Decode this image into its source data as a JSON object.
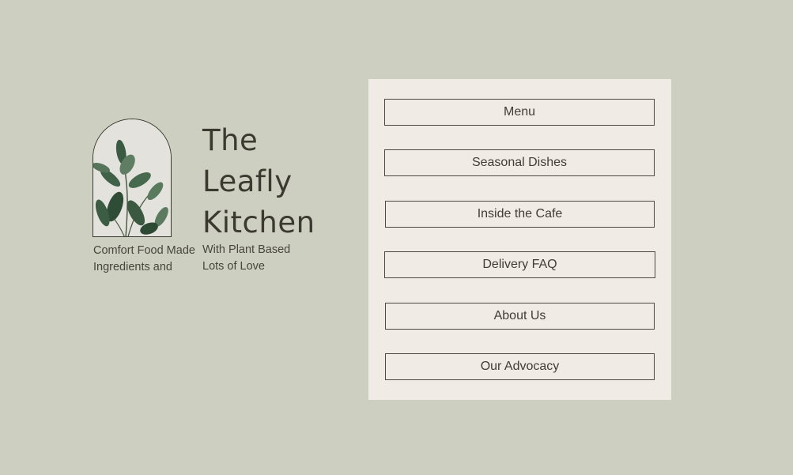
{
  "brand": {
    "title_lines": [
      "The",
      "Leafly",
      "Kitchen"
    ],
    "tagline_left": [
      "Comfort Food Made",
      "Ingredients and"
    ],
    "tagline_right": [
      "With Plant Based",
      "Lots of Love"
    ],
    "image_icon": "plant-icon"
  },
  "nav": {
    "items": [
      {
        "label": "Menu"
      },
      {
        "label": "Seasonal Dishes"
      },
      {
        "label": "Inside the Cafe"
      },
      {
        "label": "Delivery FAQ"
      },
      {
        "label": "About Us"
      },
      {
        "label": "Our Advocacy"
      }
    ]
  },
  "colors": {
    "background": "#cdcfc0",
    "panel": "#f0ebe5",
    "text": "#3b3a30",
    "leaf": "#3f5e45"
  }
}
